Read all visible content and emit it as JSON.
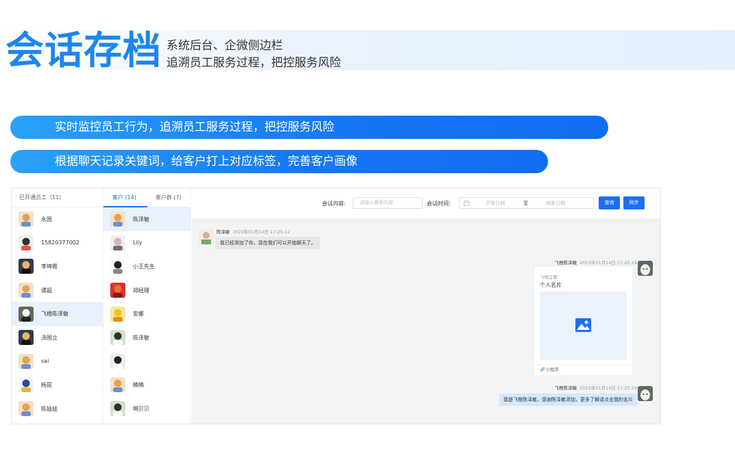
{
  "header": {
    "title": "会话存档",
    "subtitle_line1": "系统后台、企微侧边栏",
    "subtitle_line2": "追溯员工服务过程，把控服务风险"
  },
  "features": [
    "实时监控员工行为，追溯员工服务过程，把控服务风险",
    "根据聊天记录关键词，给客户打上对应标签，完善客户画像"
  ],
  "staff_panel": {
    "heading": "已开通员工（11)",
    "items": [
      {
        "name": "永国",
        "avatar": "cartoon-avatar"
      },
      {
        "name": "15820377002",
        "avatar": "user-avatar"
      },
      {
        "name": "李坤霞",
        "avatar": "landscape-avatar"
      },
      {
        "name": "谭超",
        "avatar": "cartoon-avatar"
      },
      {
        "name": "飞橙陈泽敏",
        "avatar": "alpaca-avatar",
        "selected": true
      },
      {
        "name": "汤国立",
        "avatar": "landscape-avatar"
      },
      {
        "name": "sai",
        "avatar": "cartoon-avatar"
      },
      {
        "name": "杨昆",
        "avatar": "logo-avatar"
      },
      {
        "name": "陈娃娃",
        "avatar": "cartoon-avatar"
      }
    ]
  },
  "customer_panel": {
    "tabs": [
      "客户 (14)",
      "客户群 (7)"
    ],
    "active_tab": 0,
    "items": [
      {
        "name": "陈泽敏",
        "avatar": "cartoon-avatar",
        "selected": true
      },
      {
        "name": "Lily",
        "avatar": "girl-avatar"
      },
      {
        "name": "小王先生",
        "avatar": "sketch-avatar"
      },
      {
        "name": "郑经理",
        "avatar": "red-avatar"
      },
      {
        "name": "安娜",
        "avatar": "duck-avatar"
      },
      {
        "name": "陈泽敏",
        "avatar": "sheep-avatar"
      },
      {
        "name": "",
        "avatar": "penguin-avatar"
      },
      {
        "name": "楠楠",
        "avatar": "cartoon-avatar"
      },
      {
        "name": "啊贝贝",
        "avatar": "sheep-avatar"
      }
    ]
  },
  "filter": {
    "content_label": "会话内容:",
    "content_placeholder": "请输入搜索内容",
    "time_label": "会话时间:",
    "start_placeholder": "开始日期",
    "to": "至",
    "end_placeholder": "结束日期",
    "search_button": "查询",
    "sync_button": "同步"
  },
  "messages": [
    {
      "sender": "陈泽敏",
      "time": "2023年01月14日 17:25:12",
      "side": "left",
      "text": "我已经添加了你，现在我们可以开始聊天了。"
    },
    {
      "sender": "飞橙陈泽敏",
      "time": "2023年01月14日 17:25:19",
      "side": "right",
      "type": "card",
      "card_source": "飞橙企服",
      "card_title": "个人名片",
      "card_footer": "小程序"
    },
    {
      "sender": "飞橙陈泽敏",
      "time": "2023年01月14日 17:25:19",
      "side": "right",
      "text": "我是飞橙陈泽敏，感谢陈泽敏添加，更多了解请点击我的名片"
    }
  ],
  "colors": {
    "brand": "#1d86f0",
    "primary_button": "#1d6ff2",
    "selected_row": "#e8f1fd",
    "chat_bg": "#f2f3f5",
    "right_bubble": "#d4e8fc"
  }
}
